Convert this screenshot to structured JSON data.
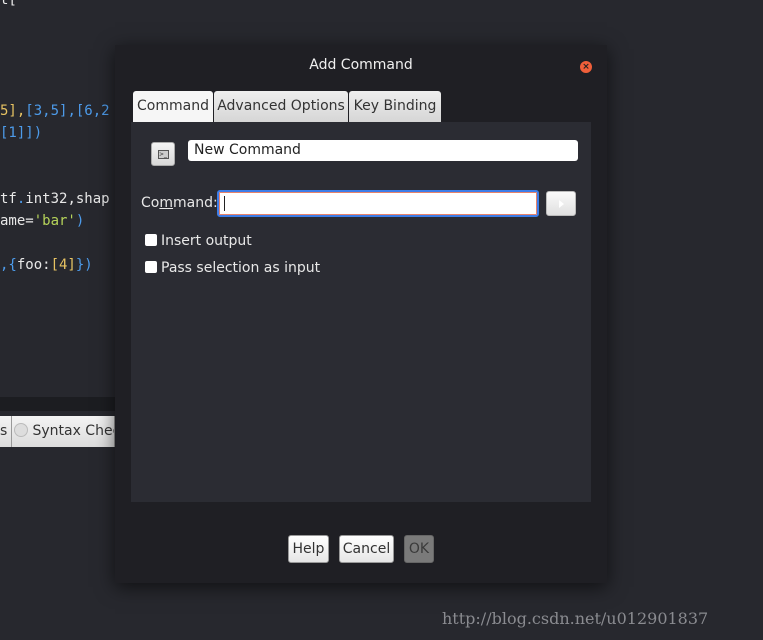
{
  "editor": {
    "lines": [
      {
        "y": "t["
      },
      {
        "a": "5],",
        "b": "[3,5]",
        "c": ",[6,2"
      },
      {
        "a": "[1]])"
      },
      {
        "a": "tf",
        "b": ".",
        "c": "int32,shap"
      },
      {
        "a": "ame=",
        "b": "'bar'",
        "c": ")"
      },
      {
        "a": ",{",
        "b": "foo:",
        "c": "[4]",
        "d": "})"
      }
    ],
    "bottom_tabs": [
      "s",
      "Syntax Check"
    ]
  },
  "dialog": {
    "title": "Add Command",
    "tabs": [
      "Command",
      "Advanced Options",
      "Key Binding"
    ],
    "name_value": "New Command",
    "command_label": "Command:",
    "command_value": "",
    "insert_output": "Insert output",
    "pass_selection": "Pass selection as input",
    "buttons": {
      "help": "Help",
      "cancel": "Cancel",
      "ok": "OK"
    }
  },
  "watermark": "http://blog.csdn.net/u012901837"
}
